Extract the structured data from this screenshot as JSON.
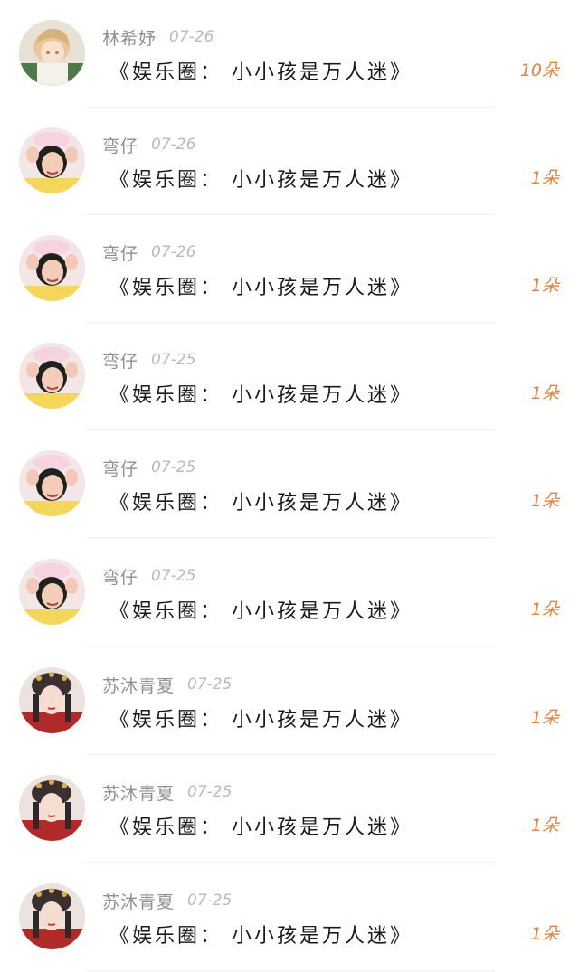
{
  "gift_list": {
    "items": [
      {
        "nickname": "林希妤",
        "date": "07-26",
        "gift": "《娱乐圈： 小小孩是万人迷》",
        "amount": "10朵",
        "avatar_icon": "anime-boy-avatar"
      },
      {
        "nickname": "弯仔",
        "date": "07-26",
        "gift": "《娱乐圈： 小小孩是万人迷》",
        "amount": "1朵",
        "avatar_icon": "girl-photo-avatar"
      },
      {
        "nickname": "弯仔",
        "date": "07-26",
        "gift": "《娱乐圈： 小小孩是万人迷》",
        "amount": "1朵",
        "avatar_icon": "girl-photo-avatar"
      },
      {
        "nickname": "弯仔",
        "date": "07-25",
        "gift": "《娱乐圈： 小小孩是万人迷》",
        "amount": "1朵",
        "avatar_icon": "girl-photo-avatar"
      },
      {
        "nickname": "弯仔",
        "date": "07-25",
        "gift": "《娱乐圈： 小小孩是万人迷》",
        "amount": "1朵",
        "avatar_icon": "girl-photo-avatar"
      },
      {
        "nickname": "弯仔",
        "date": "07-25",
        "gift": "《娱乐圈： 小小孩是万人迷》",
        "amount": "1朵",
        "avatar_icon": "girl-photo-avatar"
      },
      {
        "nickname": "苏沐青夏",
        "date": "07-25",
        "gift": "《娱乐圈： 小小孩是万人迷》",
        "amount": "1朵",
        "avatar_icon": "costume-girl-avatar"
      },
      {
        "nickname": "苏沐青夏",
        "date": "07-25",
        "gift": "《娱乐圈： 小小孩是万人迷》",
        "amount": "1朵",
        "avatar_icon": "costume-girl-avatar"
      },
      {
        "nickname": "苏沐青夏",
        "date": "07-25",
        "gift": "《娱乐圈： 小小孩是万人迷》",
        "amount": "1朵",
        "avatar_icon": "costume-girl-avatar"
      }
    ]
  },
  "colors": {
    "amount": "#e3843e",
    "nickname": "#8f8f8f",
    "date": "#b9b9b9",
    "gift_text": "#1a1a1a",
    "divider": "#efefef"
  }
}
